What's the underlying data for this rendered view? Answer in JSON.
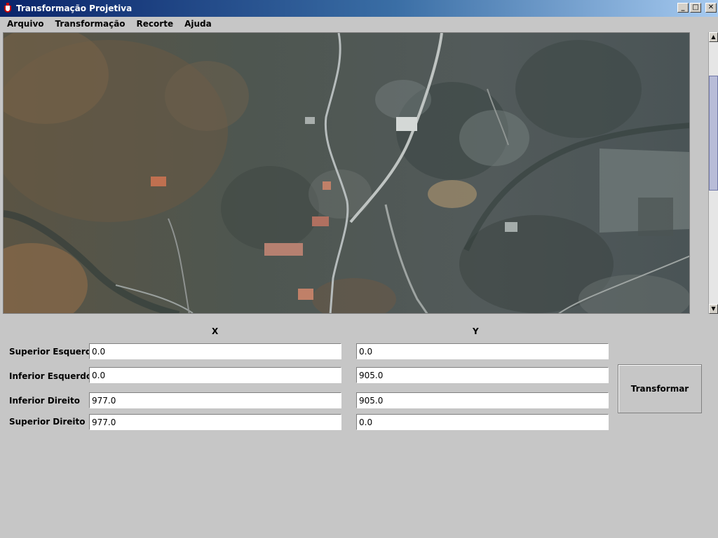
{
  "window": {
    "title": "Transformação Projetiva",
    "controls": {
      "minimize": "_",
      "maximize": "□",
      "close": "✕"
    }
  },
  "menu": [
    "Arquivo",
    "Transformação",
    "Recorte",
    "Ajuda"
  ],
  "columns": {
    "x": "X",
    "y": "Y"
  },
  "rows": [
    {
      "label": "Superior Esquerdo",
      "x": "0.0",
      "y": "0.0"
    },
    {
      "label": "Inferior Esquerdo",
      "x": "0.0",
      "y": "905.0"
    },
    {
      "label": "Inferior Direito",
      "x": "977.0",
      "y": "905.0"
    },
    {
      "label": "Superior Direito",
      "x": "977.0",
      "y": "0.0"
    }
  ],
  "transform_button": "Transformar",
  "scrollbar": {
    "up": "▲",
    "down": "▼"
  }
}
